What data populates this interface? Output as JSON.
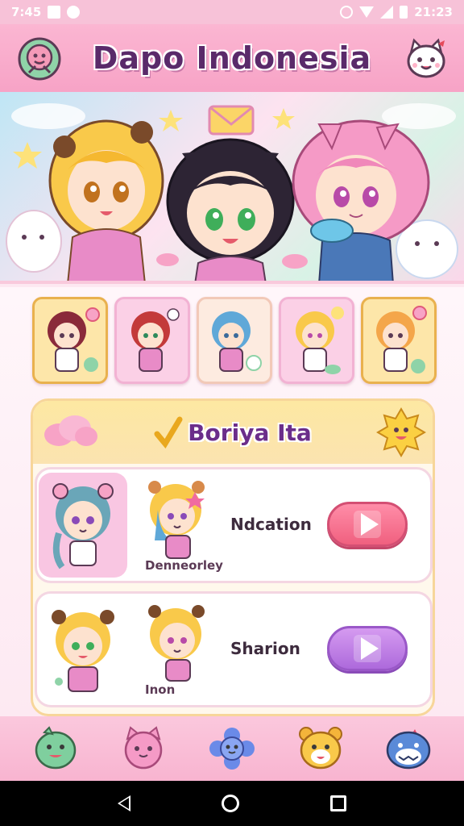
{
  "status_bar": {
    "time_left": "7:45",
    "time_right": "21:23"
  },
  "header": {
    "title": "Dapo Indonesia"
  },
  "section": {
    "title": "Boriya Ita"
  },
  "cards": [
    {
      "name": "Ndcation",
      "caption": "Denneorley"
    },
    {
      "name": "Sharion",
      "caption": "Inon"
    }
  ],
  "colors": {
    "header_pink": "#f7a3c6",
    "panel_gold": "#fde8a2",
    "play_red": "#f0607f",
    "play_purple": "#ad6adc",
    "title_purple": "#6b2d8a"
  },
  "icons": {
    "header_left": "flower-mascot-icon",
    "header_right": "cat-mascot-icon",
    "bottom_nav": [
      "dino-icon",
      "pink-cat-icon",
      "blue-flower-icon",
      "bear-icon",
      "shark-icon"
    ]
  }
}
